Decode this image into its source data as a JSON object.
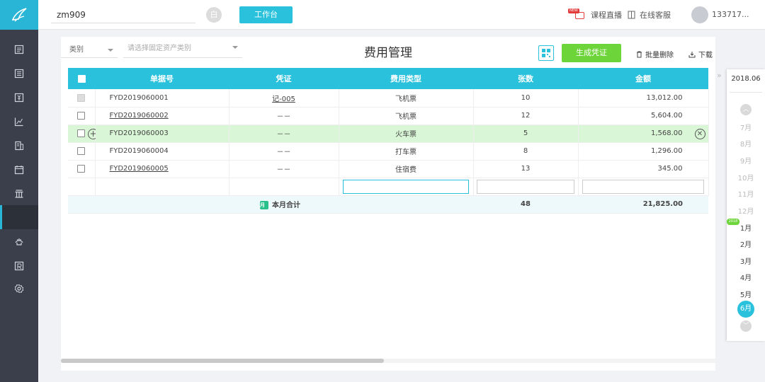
{
  "topbar": {
    "company": "zm909",
    "switch_icon": "白",
    "workbench": "工作台",
    "live": "课程直播",
    "live_badge": "NEW",
    "service": "在线客服",
    "user": "133717..."
  },
  "filters": {
    "category": "类别",
    "asset_placeholder": "请选择固定资产类别"
  },
  "page": {
    "title": "费用管理",
    "generate": "生成凭证",
    "batch_delete": "批量删除",
    "download": "下载"
  },
  "table": {
    "headers": [
      "单据号",
      "凭证",
      "费用类型",
      "张数",
      "金额"
    ],
    "rows": [
      {
        "code": "FYD2019060001",
        "voucher": "记-005",
        "type": "飞机票",
        "count": "10",
        "amount": "13,012.00"
      },
      {
        "code": "FYD2019060002",
        "voucher": "－－",
        "type": "飞机票",
        "count": "12",
        "amount": "5,604.00"
      },
      {
        "code": "FYD2019060003",
        "voucher": "－－",
        "type": "火车票",
        "count": "5",
        "amount": "1,568.00"
      },
      {
        "code": "FYD2019060004",
        "voucher": "－－",
        "type": "打车票",
        "count": "8",
        "amount": "1,296.00"
      },
      {
        "code": "FYD2019060005",
        "voucher": "－－",
        "type": "住宿费",
        "count": "13",
        "amount": "345.00"
      }
    ],
    "total": {
      "icon_text": "月",
      "label": "本月合计",
      "count": "48",
      "amount": "21,825.00"
    }
  },
  "datepanel": {
    "collapse": "»",
    "year": "2018.06",
    "year_tag": "2018",
    "months": [
      "7月",
      "8月",
      "9月",
      "10月",
      "11月",
      "12月",
      "1月",
      "2月",
      "3月",
      "4月",
      "5月",
      "6月"
    ]
  },
  "icons": {
    "nav": [
      "ledger-icon",
      "voucher-icon",
      "tax-icon",
      "chart-icon",
      "report-icon",
      "calendar-icon",
      "bank-icon",
      "active-blank",
      "hand-icon",
      "asset-icon",
      "settings-icon"
    ]
  },
  "colors": {
    "accent": "#29c1dc",
    "sidebar": "#3a3f4b",
    "generate": "#6dd43a",
    "highlight_row": "#d9f7d6"
  }
}
